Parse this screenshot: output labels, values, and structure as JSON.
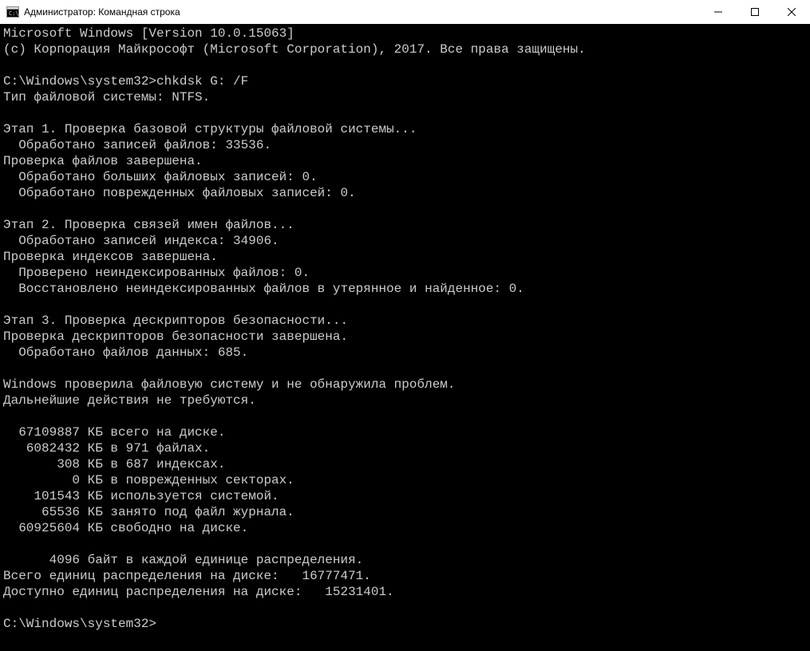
{
  "window": {
    "title": "Администратор: Командная строка"
  },
  "terminal": {
    "lines": [
      "Microsoft Windows [Version 10.0.15063]",
      "(c) Корпорация Майкрософт (Microsoft Corporation), 2017. Все права защищены.",
      "",
      "C:\\Windows\\system32>chkdsk G: /F",
      "Тип файловой системы: NTFS.",
      "",
      "Этап 1. Проверка базовой структуры файловой системы...",
      "  Обработано записей файлов: 33536.",
      "Проверка файлов завершена.",
      "  Обработано больших файловых записей: 0.",
      "  Обработано поврежденных файловых записей: 0.",
      "",
      "Этап 2. Проверка связей имен файлов...",
      "  Обработано записей индекса: 34906.",
      "Проверка индексов завершена.",
      "  Проверено неиндексированных файлов: 0.",
      "  Восстановлено неиндексированных файлов в утерянное и найденное: 0.",
      "",
      "Этап 3. Проверка дескрипторов безопасности...",
      "Проверка дескрипторов безопасности завершена.",
      "  Обработано файлов данных: 685.",
      "",
      "Windows проверила файловую систему и не обнаружила проблем.",
      "Дальнейшие действия не требуются.",
      "",
      "  67109887 КБ всего на диске.",
      "   6082432 КБ в 971 файлах.",
      "       308 КБ в 687 индексах.",
      "         0 КБ в поврежденных секторах.",
      "    101543 КБ используется системой.",
      "     65536 КБ занято под файл журнала.",
      "  60925604 КБ свободно на диске.",
      "",
      "      4096 байт в каждой единице распределения.",
      "Всего единиц распределения на диске:   16777471.",
      "Доступно единиц распределения на диске:   15231401.",
      "",
      "C:\\Windows\\system32>"
    ]
  }
}
